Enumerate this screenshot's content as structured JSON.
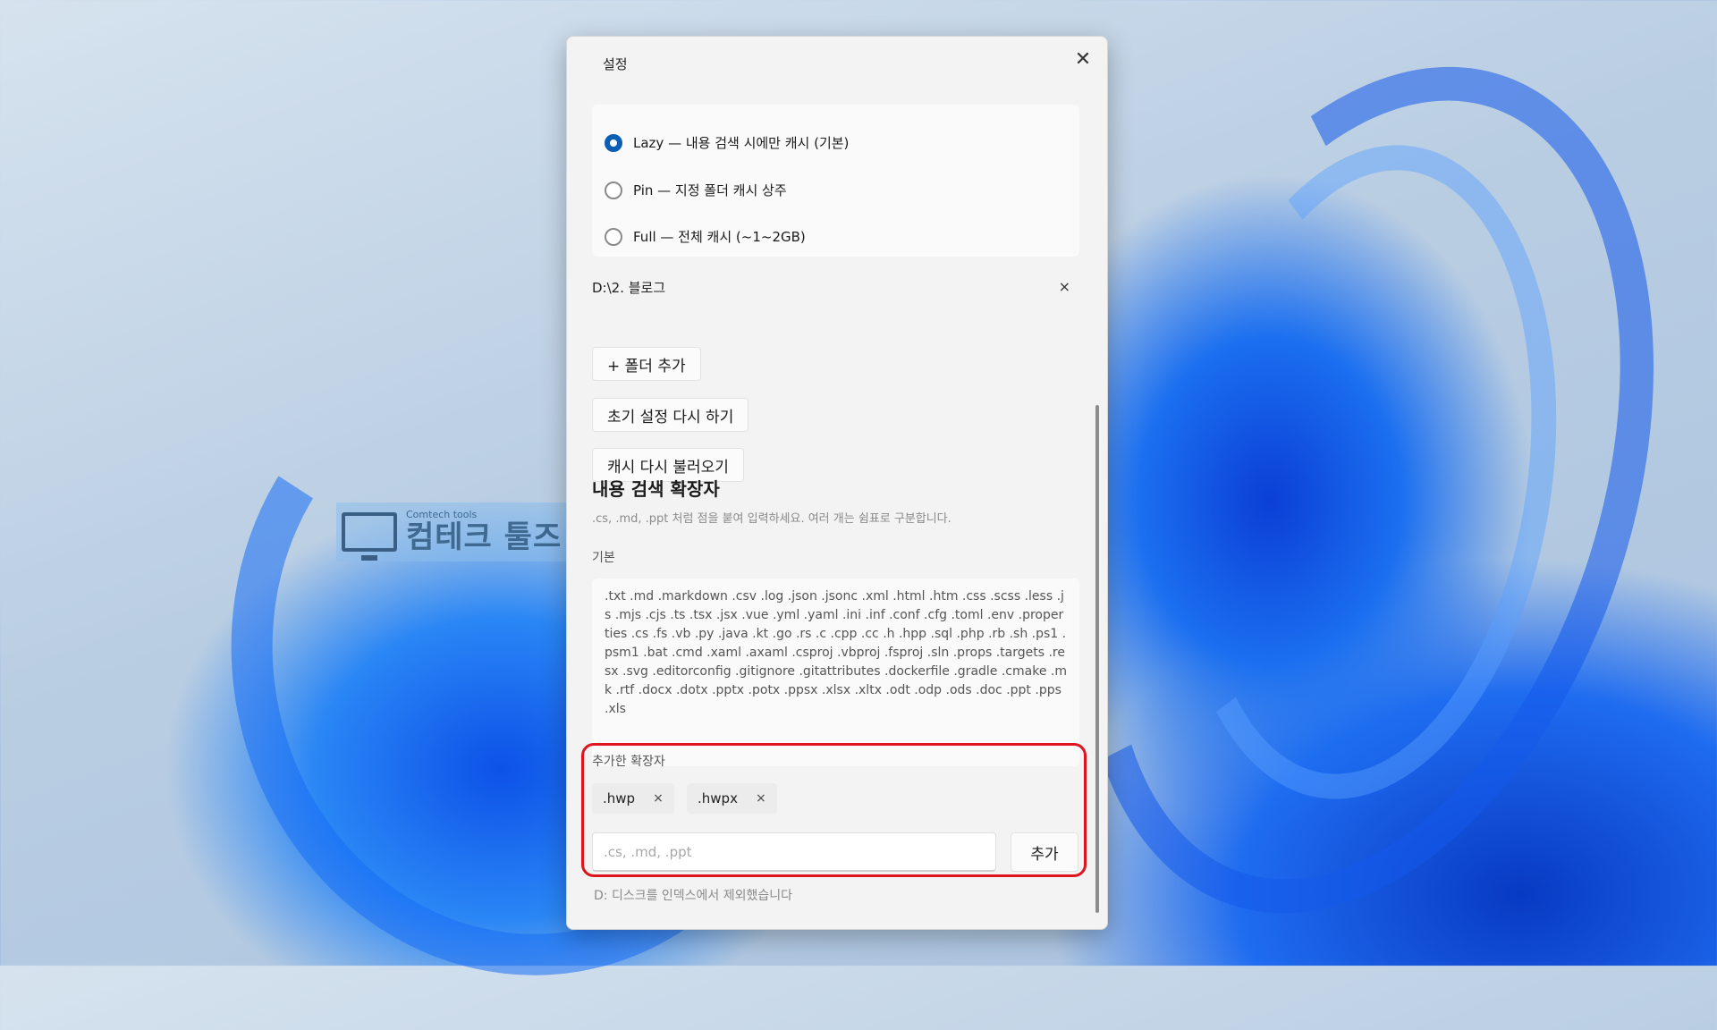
{
  "dialog": {
    "title": "설정",
    "close_icon": "close-icon"
  },
  "cache_modes": [
    {
      "label": "Lazy — 내용 검색 시에만 캐시 (기본)",
      "selected": true
    },
    {
      "label": "Pin — 지정 폴더 캐시 상주",
      "selected": false
    },
    {
      "label": "Full — 전체 캐시 (~1~2GB)",
      "selected": false
    }
  ],
  "pinned_folder": {
    "path": "D:\\2. 블로그",
    "remove_label": "×"
  },
  "buttons": {
    "add_folder": "+ 폴더 추가",
    "reset_setup": "초기 설정 다시 하기",
    "reload_cache": "캐시 다시 불러오기"
  },
  "extensions": {
    "heading": "내용 검색 확장자",
    "hint": ".cs, .md, .ppt 처럼 점을 붙여 입력하세요. 여러 개는 쉼표로 구분합니다.",
    "default_label": "기본",
    "default_list": ".txt .md .markdown .csv .log .json .jsonc .xml .html .htm .css .scss .less .js .mjs .cjs .ts .tsx .jsx .vue .yml .yaml .ini .inf .conf .cfg .toml .env .properties .cs .fs .vb .py .java .kt .go .rs .c .cpp .cc .h .hpp .sql .php .rb .sh .ps1 .psm1 .bat .cmd .xaml .axaml .csproj .vbproj .fsproj .sln .props .targets .resx .svg .editorconfig .gitignore .gitattributes .dockerfile .gradle .cmake .mk .rtf .docx .dotx .pptx .potx .ppsx .xlsx .xltx .odt .odp .ods .doc .ppt .pps .xls",
    "added_label": "추가한 확장자",
    "added": [
      {
        "name": ".hwp",
        "remove": "×"
      },
      {
        "name": ".hwpx",
        "remove": "×"
      }
    ],
    "input_placeholder": ".cs, .md, .ppt",
    "input_value": "",
    "add_button": "추가"
  },
  "status_text": "D: 디스크를 인덱스에서 제외했습니다",
  "watermark": {
    "small": "Comtech tools",
    "big": "컴테크 툴즈"
  },
  "colors": {
    "accent": "#0a5fb4",
    "highlight": "#e0141f"
  }
}
